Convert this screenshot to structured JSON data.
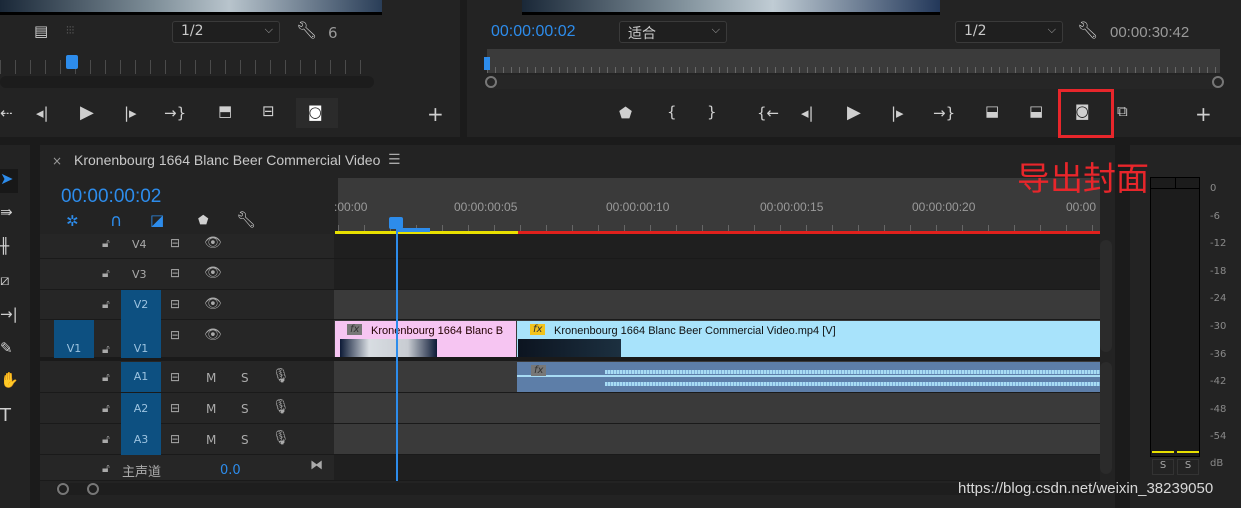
{
  "source_monitor": {
    "zoom": "1/2",
    "wrench_value": "6"
  },
  "program_monitor": {
    "timecode": "00:00:00:02",
    "fit": "适合",
    "zoom": "1/2",
    "duration": "00:00:30:42"
  },
  "timeline": {
    "sequence_title": "Kronenbourg 1664 Blanc Beer Commercial Video",
    "timecode": "00:00:00:02",
    "ruler_labels": [
      ":00:00",
      "00:00:00:05",
      "00:00:00:10",
      "00:00:00:15",
      "00:00:00:20",
      "00:00"
    ],
    "video_tracks": [
      "V4",
      "V3",
      "V2",
      "V1"
    ],
    "source_patch": "V1",
    "audio_tracks": [
      "A1",
      "A2",
      "A3"
    ],
    "mute_label": "M",
    "solo_label": "S",
    "master": {
      "label": "主声道",
      "value": "0.0"
    },
    "clips": {
      "clip1": "Kronenbourg 1664 Blanc B",
      "clip2": "Kronenbourg 1664 Blanc Beer Commercial Video.mp4 [V]",
      "fx": "fx"
    }
  },
  "meter": {
    "scale": [
      "0",
      "-6",
      "-12",
      "-18",
      "-24",
      "-30",
      "-36",
      "-42",
      "-48",
      "-54",
      "dB"
    ],
    "solo": [
      "S",
      "S"
    ]
  },
  "annotation": {
    "label": "导出封面",
    "color": "#e8262b"
  },
  "watermark": "https://blog.csdn.net/weixin_38239050"
}
